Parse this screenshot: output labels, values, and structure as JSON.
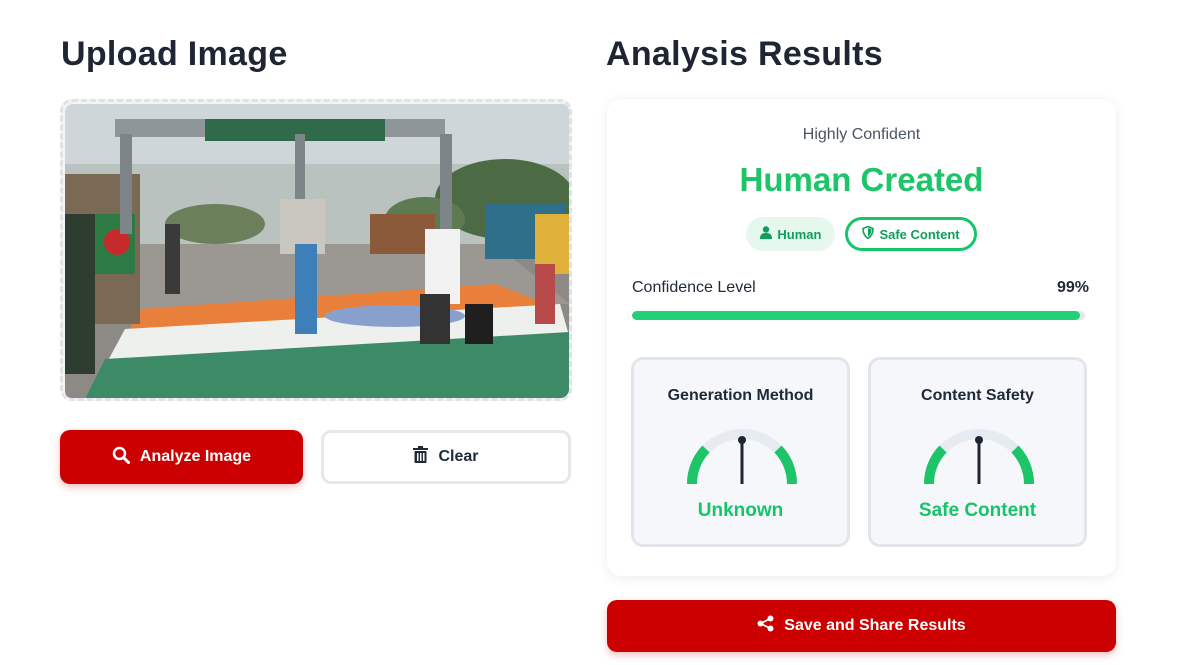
{
  "upload": {
    "heading": "Upload Image",
    "image_alt": "uploaded-photo",
    "analyze_label": "Analyze Image",
    "clear_label": "Clear"
  },
  "results": {
    "heading": "Analysis Results",
    "confidence_text": "Highly Confident",
    "verdict": "Human Created",
    "badges": [
      {
        "label": "Human",
        "icon": "user-icon"
      },
      {
        "label": "Safe Content",
        "icon": "shield-icon"
      }
    ],
    "confidence": {
      "label": "Confidence Level",
      "value_text": "99%",
      "value": 0.99
    },
    "meters": [
      {
        "title": "Generation Method",
        "value": "Unknown",
        "level": 0.5
      },
      {
        "title": "Content Safety",
        "value": "Safe Content",
        "level": 0.5
      }
    ],
    "share_label": "Save and Share Results"
  },
  "colors": {
    "primary": "#cc0000",
    "success": "#16c56a",
    "heading": "#1e2533"
  }
}
